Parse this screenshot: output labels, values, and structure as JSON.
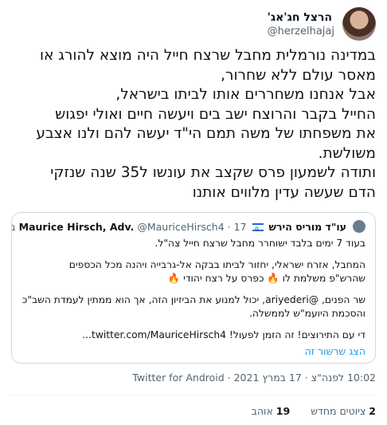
{
  "author": {
    "display_name": "הרצל חג'אג'",
    "handle": "@herzelhajaj"
  },
  "tweet_lines": [
    "במדינה נורמלית מחבל שרצח חייל היה מוצא להורג או",
    "מאסר עולם ללא שחרור,",
    "אבל אנחנו משחררים אותו לביתו בישראל,",
    "החייל בקבר והרוצח ישב בים ויעשה חיים ואולי יפגוש",
    "את משפחתו של משה תמם הי\"ד יעשה להם ולנו אצבע",
    "משולשת.",
    "ותודה לשמעון פרס שקצב את עונשו ל35 שנה שנזקי",
    "הדם שעשה עדין מלווים אותנו"
  ],
  "quote": {
    "display_name_he": "עו\"ד מוריס הירש",
    "display_name_en": "Maurice Hirsch, Adv.",
    "handle": "@MauriceHirsch4",
    "date": "17 במרץ",
    "separator": "·",
    "lines": [
      "בעוד 7 ימים בלבד ישוחרר מחבל שרצח חייל צה\"ל.",
      "",
      "המחבל, אזרח ישראלי, יחזור לביתו בבקה אל-גרבייה ויהנה מכל הכספים",
      "שהרש\"פ משלמת לו 🔥 כפרס על רצח יהודי 🔥",
      "",
      "שר הפנים, @ariyederi, יכול למנוע את הביזיון הזה, אך הוא ממתין לעמדת השב\"כ",
      "והסכמת היועמ\"ש לממשלה.",
      "",
      "די עם התירוצים! זה הזמן לפעול! twitter.com/MauriceHirsch4..."
    ],
    "show_thread": "הצג שרשור זה"
  },
  "meta": {
    "time": "10:02 לפנה\"צ",
    "date": "17 במרץ 2021",
    "source": "Twitter for Android"
  },
  "stats": {
    "quote_count": "2",
    "quote_label": "ציוטים מחדש",
    "like_count": "19",
    "like_label": "אוהב"
  },
  "colors": {
    "link": "#1d9bf0",
    "secondary_text": "#536471",
    "border": "#cfd9de"
  }
}
